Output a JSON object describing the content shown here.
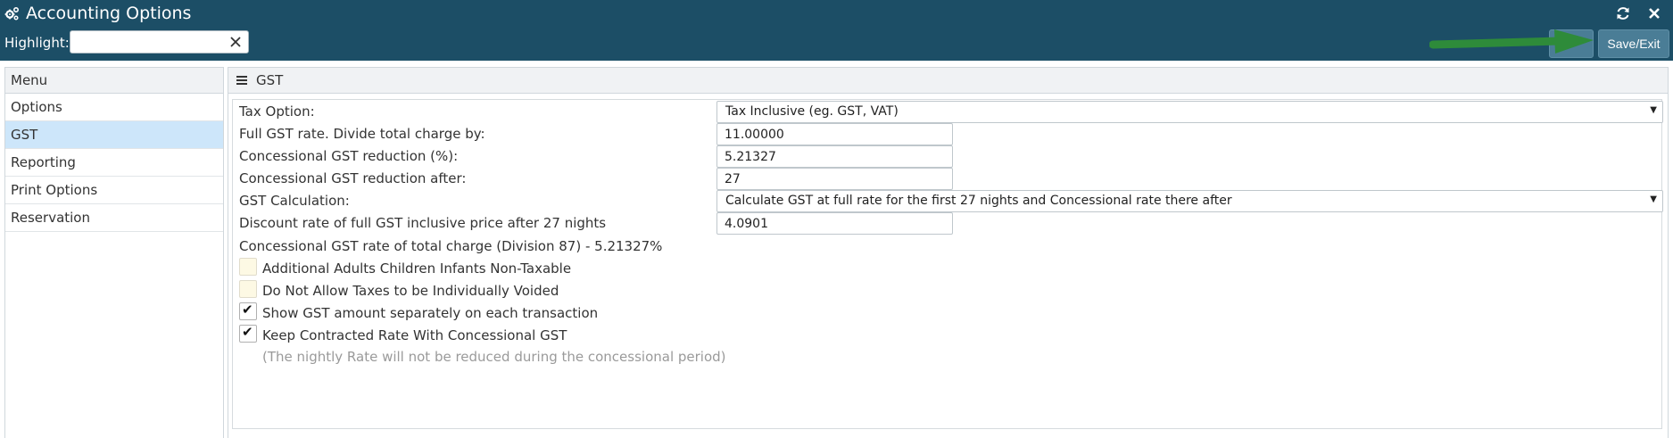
{
  "window": {
    "title": "Accounting Options",
    "title_icon": "gears-icon",
    "controls": [
      "refresh-icon",
      "close-icon"
    ]
  },
  "toolbar": {
    "highlight_label": "Highlight:",
    "highlight_value": "",
    "clear_icon": "close-icon",
    "save_exit_label": "Save/Exit",
    "annotation_arrow_color": "#2e8b3a"
  },
  "sidebar": {
    "header": "Menu",
    "items": [
      {
        "label": "Options",
        "active": false
      },
      {
        "label": "GST",
        "active": true
      },
      {
        "label": "Reporting",
        "active": false
      },
      {
        "label": "Print Options",
        "active": false
      },
      {
        "label": "Reservation",
        "active": false
      }
    ]
  },
  "main": {
    "title": "GST",
    "tax_option": {
      "label": "Tax Option:",
      "value": "Tax Inclusive (eg. GST, VAT)"
    },
    "full_rate": {
      "label": "Full GST rate. Divide total charge by:",
      "value": "11.00000"
    },
    "concessional_reduction": {
      "label": "Concessional GST reduction (%):",
      "value": "5.21327"
    },
    "reduction_after": {
      "label": "Concessional GST reduction after:",
      "value": "27"
    },
    "gst_calculation": {
      "label": "GST Calculation:",
      "value": "Calculate GST at full rate for the first 27 nights and Concessional rate there after"
    },
    "discount_rate": {
      "label": "Discount rate of full GST inclusive price after 27 nights",
      "value": "4.0901"
    },
    "concessional_info": "Concessional GST rate of total charge (Division 87) - 5.21327%",
    "checkboxes": [
      {
        "label": "Additional Adults Children Infants Non-Taxable",
        "checked": false
      },
      {
        "label": "Do Not Allow Taxes to be Individually Voided",
        "checked": false
      },
      {
        "label": "Show GST amount separately on each transaction",
        "checked": true
      },
      {
        "label": "Keep Contracted Rate With Concessional GST",
        "checked": true
      }
    ],
    "note": "(The nightly Rate will not be reduced during the concessional period)"
  },
  "colors": {
    "header_bg": "#1c4e66",
    "button_bg": "#4a7d96",
    "active_menu_bg": "#cde6fa",
    "unchecked_box_bg": "#fdf9e4"
  }
}
